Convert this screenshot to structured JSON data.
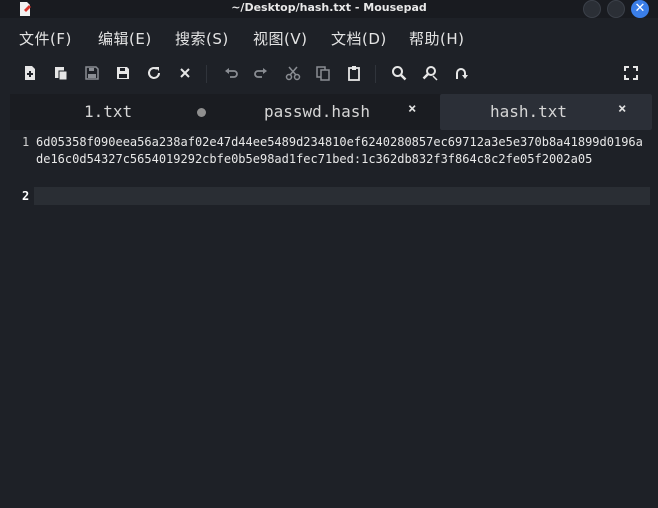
{
  "window": {
    "title": "~/Desktop/hash.txt - Mousepad"
  },
  "menu": [
    {
      "label": "文件(F)"
    },
    {
      "label": "编辑(E)"
    },
    {
      "label": "搜索(S)"
    },
    {
      "label": "视图(V)"
    },
    {
      "label": "文档(D)"
    },
    {
      "label": "帮助(H)"
    }
  ],
  "toolbar": {
    "icons": [
      "new-document-icon",
      "new-window-icon",
      "save-icon",
      "save-as-icon",
      "reload-icon",
      "close-document-icon",
      "undo-icon",
      "redo-icon",
      "cut-icon",
      "copy-icon",
      "paste-icon",
      "search-icon",
      "find-replace-icon",
      "go-to-line-icon",
      "fullscreen-icon"
    ]
  },
  "tabs": [
    {
      "label": "1.txt",
      "modified": true
    },
    {
      "label": "passwd.hash",
      "close": "×"
    },
    {
      "label": "hash.txt",
      "close": "×",
      "active": true
    }
  ],
  "editor": {
    "lines": [
      {
        "number": "1",
        "text": "6d05358f090eea56a238af02e47d44ee5489d234810ef6240280857ec69712a3e5e370b8a41899d0196ade16c0d54327c5654019292cbfe0b5e98ad1fec71bed:1c362db832f3f864c8c2fe05f2002a05"
      },
      {
        "number": "2",
        "text": ""
      }
    ],
    "current_line": 2
  }
}
